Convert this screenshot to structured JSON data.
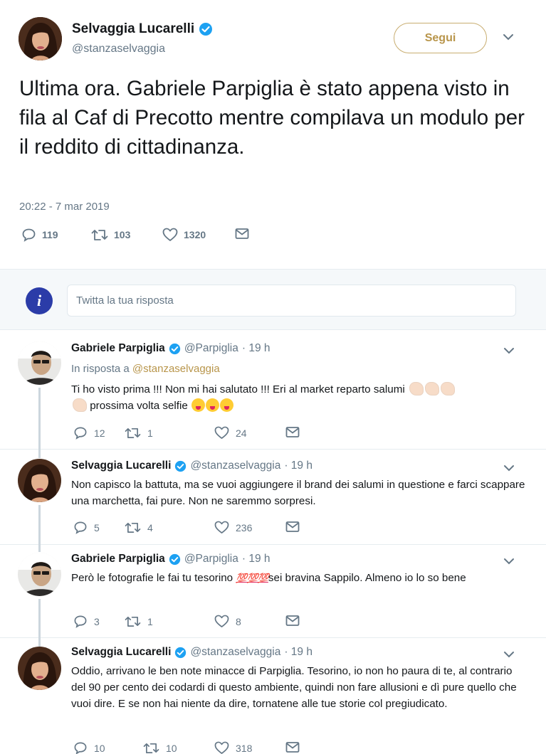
{
  "main_tweet": {
    "name": "Selvaggia Lucarelli",
    "handle": "@stanzaselvaggia",
    "follow_label": "Segui",
    "text": "Ultima ora. Gabriele Parpiglia è stato appena visto in fila al Caf di Precotto mentre compilava un modulo per il reddito di cittadinanza.",
    "timestamp": "20:22 - 7 mar 2019",
    "replies": "119",
    "retweets": "103",
    "likes": "1320"
  },
  "reply_box": {
    "placeholder": "Twitta la tua risposta"
  },
  "replies": [
    {
      "name": "Gabriele Parpiglia",
      "handle": "@Parpiglia",
      "time": "· 19 h",
      "in_reply_prefix": "In risposta a",
      "in_reply_handle": "@stanzaselvaggia",
      "text_part1": "Ti ho visto prima !!! Non mi hai salutato !!! Eri al market reparto salumi",
      "text_part2": "prossima volta selfie",
      "replies": "12",
      "retweets": "1",
      "likes": "24"
    },
    {
      "name": "Selvaggia Lucarelli",
      "handle": "@stanzaselvaggia",
      "time": "· 19 h",
      "text": "Non capisco la battuta, ma se vuoi aggiungere il brand dei salumi in questione e farci scappare una marchetta, fai pure. Non ne saremmo sorpresi.",
      "replies": "5",
      "retweets": "4",
      "likes": "236"
    },
    {
      "name": "Gabriele Parpiglia",
      "handle": "@Parpiglia",
      "time": "· 19 h",
      "text_part1": "Però le fotografie le fai tu tesorino",
      "emoji_100": "💯💯💯",
      "text_part2": "sei bravina Sappilo. Almeno io lo so bene",
      "replies": "3",
      "retweets": "1",
      "likes": "8"
    },
    {
      "name": "Selvaggia Lucarelli",
      "handle": "@stanzaselvaggia",
      "time": "· 19 h",
      "text": "Oddio, arrivano le ben note minacce di Parpiglia. Tesorino, io non ho paura di te, al contrario del 90 per cento dei codardi di questo ambiente, quindi non fare allusioni e dì pure quello che vuoi dire. E se non hai niente da dire, tornatene alle tue storie col pregiudicato.",
      "replies": "10",
      "retweets": "10",
      "likes": "318"
    }
  ],
  "colors": {
    "accent_gold": "#b8954a",
    "verified_blue": "#1da1f2",
    "muted_text": "#657786",
    "separator": "#e6ecf0"
  }
}
